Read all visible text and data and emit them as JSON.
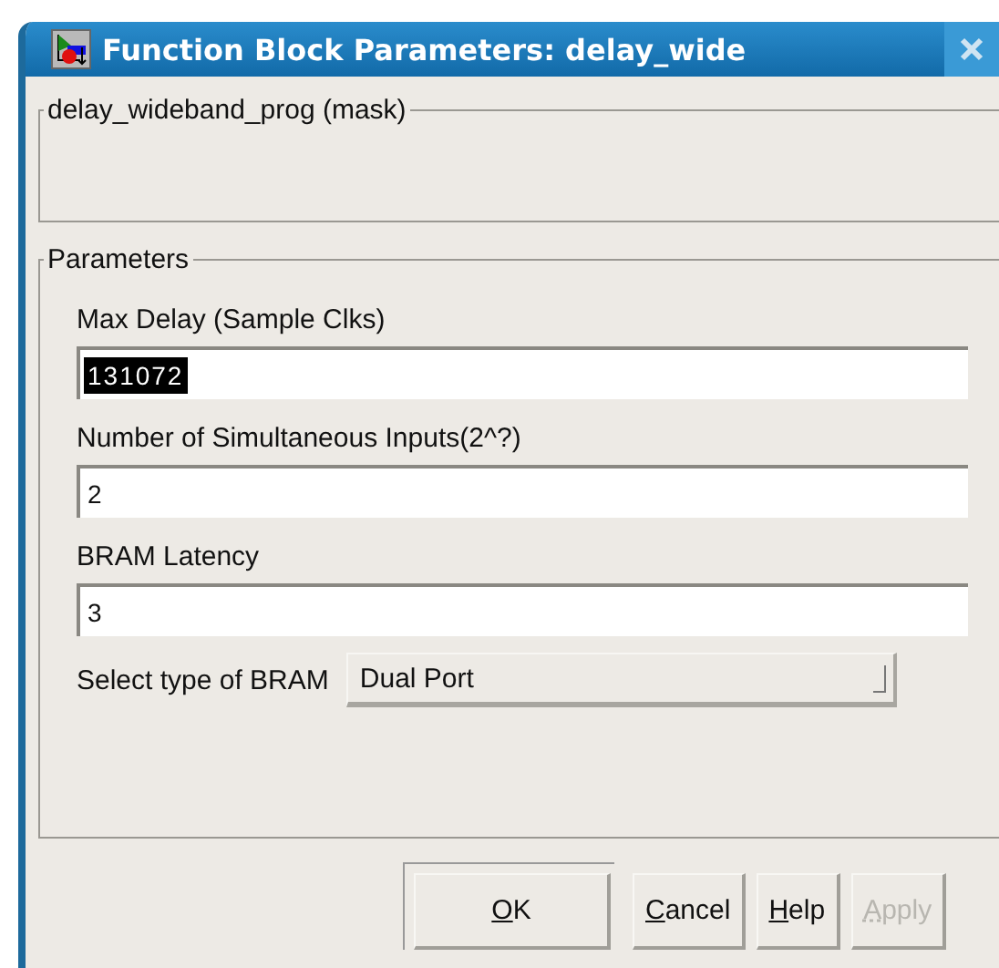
{
  "window": {
    "title": "Function Block Parameters: delay_wide"
  },
  "mask_group": {
    "title": "delay_wideband_prog (mask)"
  },
  "parameters_group": {
    "title": "Parameters",
    "items": [
      {
        "kind": "edit",
        "label": "Max Delay (Sample Clks)",
        "value": "131072",
        "text_selected": true
      },
      {
        "kind": "edit",
        "label": "Number of Simultaneous Inputs(2^?)",
        "value": "2",
        "text_selected": false
      },
      {
        "kind": "edit",
        "label": "BRAM Latency",
        "value": "3",
        "text_selected": false
      },
      {
        "kind": "popup",
        "label": "Select type of BRAM",
        "value": "Dual Port"
      }
    ]
  },
  "buttons": [
    {
      "label": "OK",
      "default": true,
      "disabled": false
    },
    {
      "label": "Cancel",
      "default": false,
      "disabled": false
    },
    {
      "label": "Help",
      "default": false,
      "disabled": false
    },
    {
      "label": "Apply",
      "default": false,
      "disabled": true
    }
  ]
}
